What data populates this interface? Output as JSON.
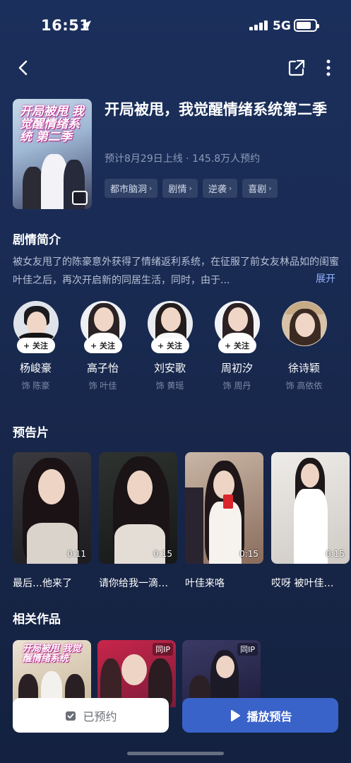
{
  "status": {
    "time": "16:51",
    "network": "5G",
    "battery_level": 0.8
  },
  "show": {
    "title": "开局被甩，我觉醒情绪系统第二季",
    "meta": "预计8月29日上线 · 145.8万人预约",
    "poster_title": "开局被甩 我觉醒情绪系统 第二季",
    "tags": [
      "都市脑洞",
      "剧情",
      "逆袭",
      "喜剧"
    ]
  },
  "synopsis": {
    "heading": "剧情简介",
    "text": "被女友甩了的陈豪意外获得了情绪返利系统，在征服了前女友林品如的闺蜜叶佳之后，再次开启新的同居生活，同时，由于...",
    "expand_label": "展开"
  },
  "cast": [
    {
      "name": "杨峻豪",
      "role": "饰 陈豪",
      "follow": "+ 关注"
    },
    {
      "name": "高子怡",
      "role": "饰 叶佳",
      "follow": "+ 关注"
    },
    {
      "name": "刘安歌",
      "role": "饰 黄瑶",
      "follow": "+ 关注"
    },
    {
      "name": "周初汐",
      "role": "饰 周丹",
      "follow": "+ 关注"
    },
    {
      "name": "徐诗颖",
      "role": "饰 高依依",
      "follow": ""
    }
  ],
  "trailers": {
    "heading": "预告片",
    "items": [
      {
        "title": "最后…他来了",
        "duration": "0:11"
      },
      {
        "title": "请你给我一滴…",
        "duration": "0:15"
      },
      {
        "title": "叶佳来咯",
        "duration": "0:15"
      },
      {
        "title": "哎呀 被叶佳…",
        "duration": "0:15"
      }
    ]
  },
  "related": {
    "heading": "相关作品",
    "items": [
      {
        "badge": "",
        "poster_text": "开局被甩 我觉醒情绪系统"
      },
      {
        "badge": "同IP",
        "poster_text": ""
      },
      {
        "badge": "同IP",
        "poster_text": ""
      }
    ]
  },
  "actions": {
    "booked_label": "已预约",
    "play_label": "播放预告"
  },
  "colors": {
    "background": "#1a2c55",
    "accent": "#3a63c9",
    "link": "#8fb3ff"
  }
}
